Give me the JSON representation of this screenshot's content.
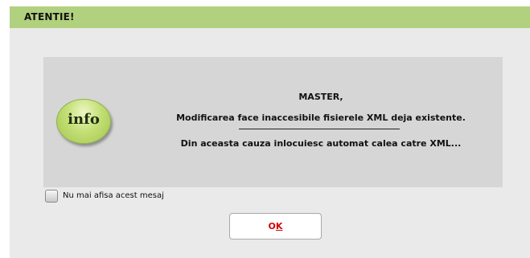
{
  "dialog": {
    "title": "ATENTIE!",
    "icon_name": "info-icon",
    "icon_label": "info",
    "message": {
      "line1": "MASTER,",
      "line2": "Modificarea face inaccesibile fisierele XML deja existente.",
      "line3": "Din aceasta cauza inlocuiesc automat calea catre XML..."
    },
    "checkbox": {
      "label": "Nu mai afisa acest mesaj",
      "checked": false
    },
    "ok_button": {
      "label": "OK",
      "accent_color": "#d40000"
    }
  },
  "colors": {
    "title_bar": "#b1d17f",
    "dialog_background": "#eaeaea",
    "message_panel": "#d6d6d6"
  }
}
